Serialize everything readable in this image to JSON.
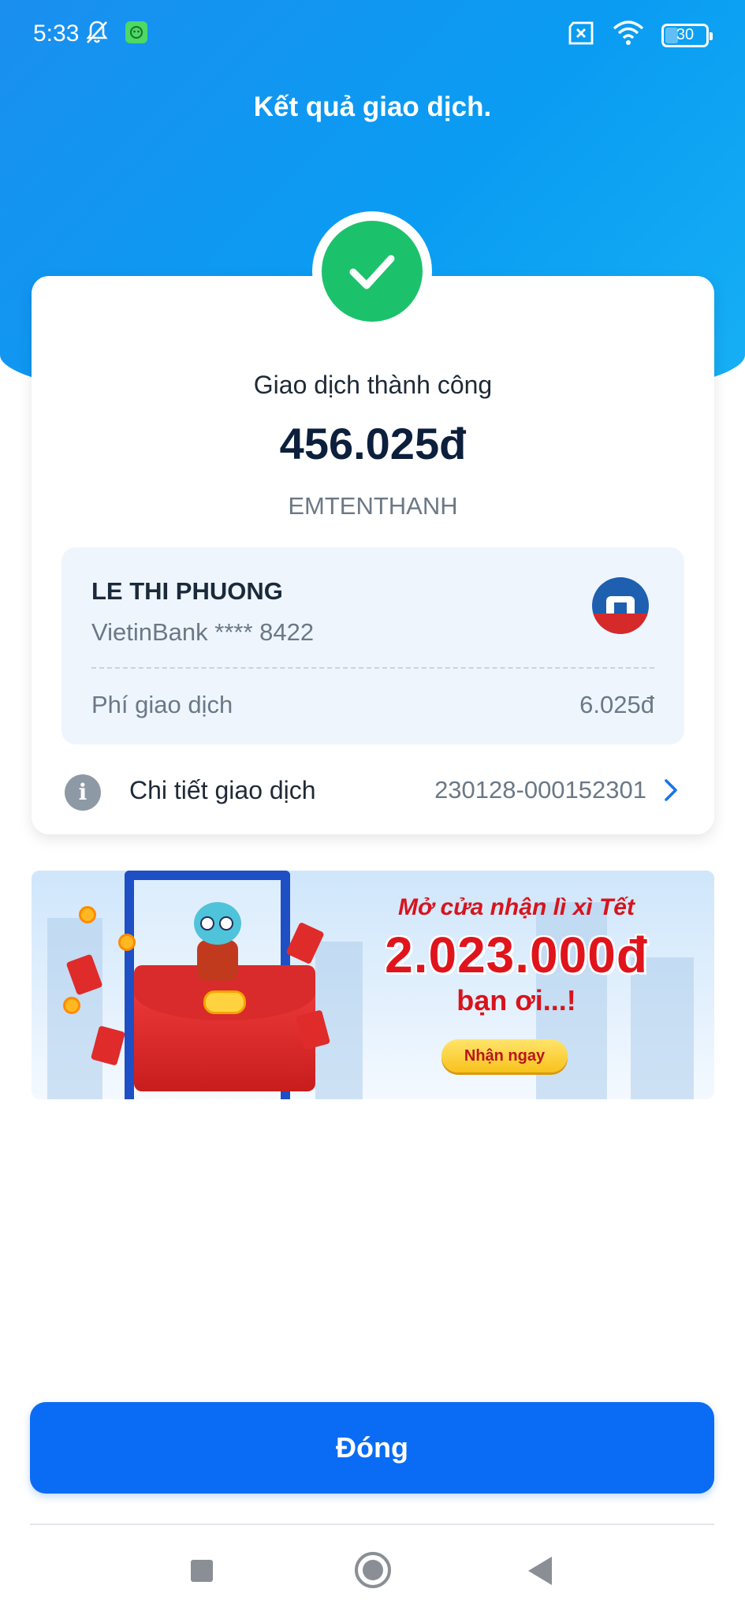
{
  "status_bar": {
    "time": "5:33",
    "battery": "30",
    "icons": [
      "mute-bell-icon",
      "app-notification-icon",
      "sim-error-icon",
      "wifi-icon",
      "battery-icon"
    ]
  },
  "header": {
    "title": "Kết quả giao dịch."
  },
  "result": {
    "status": "Giao dịch thành công",
    "amount": "456.025đ",
    "note": "EMTENTHANH",
    "success_color": "#1cc26b"
  },
  "recipient": {
    "name": "LE THI PHUONG",
    "bank_account": "VietinBank **** 8422",
    "fee_label": "Phí giao dịch",
    "fee_value": "6.025đ",
    "bank_logo": "vietinbank-logo"
  },
  "details": {
    "label": "Chi tiết giao dịch",
    "transaction_id": "230128-000152301"
  },
  "banner": {
    "line1": "Mở cửa nhận lì xì Tết",
    "line2": "2.023.000đ",
    "line3": "bạn ơi...!",
    "cta": "Nhận ngay"
  },
  "actions": {
    "close_label": "Đóng",
    "primary_color": "#0a6cf5"
  },
  "nav": {
    "icons": [
      "recent-apps-icon",
      "home-icon",
      "back-icon"
    ]
  }
}
